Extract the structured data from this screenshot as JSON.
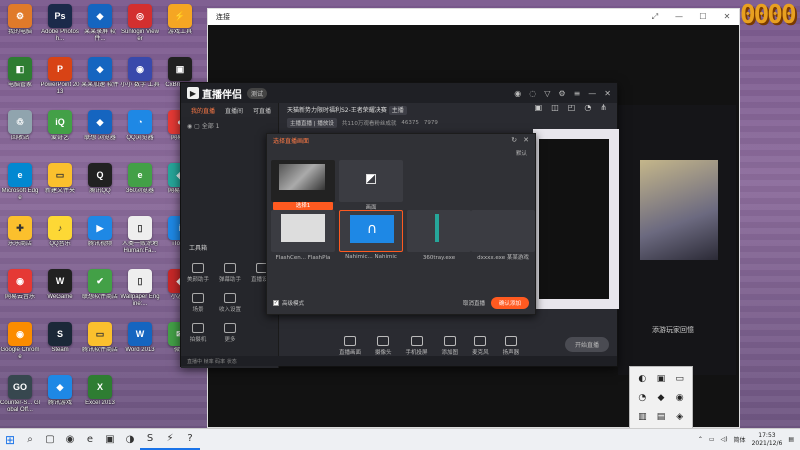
{
  "desktop": {
    "banner": "0000",
    "icons": [
      {
        "label": "我的电脑",
        "color": "#e07a2a",
        "glyph": "⚙"
      },
      {
        "label": "Adobe Photosh...",
        "color": "#1b2a4a",
        "glyph": "Ps"
      },
      {
        "label": "某某录屏 软件...",
        "color": "#1565c0",
        "glyph": "◆"
      },
      {
        "label": "Sunlogin Viewer",
        "color": "#d32f2f",
        "glyph": "◎"
      },
      {
        "label": "游戏工具",
        "color": "#f5a623",
        "glyph": "⚡"
      },
      {
        "label": "电脑管家",
        "color": "#2e7d32",
        "glyph": "◧"
      },
      {
        "label": "PowerPoint 2013",
        "color": "#d84315",
        "glyph": "P"
      },
      {
        "label": "某某加速 软件",
        "color": "#1565c0",
        "glyph": "◆"
      },
      {
        "label": "小小 数字 工具",
        "color": "#3949ab",
        "glyph": "◉"
      },
      {
        "label": "CxBrowser",
        "color": "#212121",
        "glyph": "▣"
      },
      {
        "label": "回收站",
        "color": "#90a4ae",
        "glyph": "♲"
      },
      {
        "label": "爱奇艺",
        "color": "#43a047",
        "glyph": "iQ"
      },
      {
        "label": "联想 浏览器",
        "color": "#1565c0",
        "glyph": "◆"
      },
      {
        "label": "QQ浏览器",
        "color": "#1e88e5",
        "glyph": "◔"
      },
      {
        "label": "网易云",
        "color": "#e53935",
        "glyph": "◐"
      },
      {
        "label": "Microsoft Edge",
        "color": "#0288d1",
        "glyph": "e"
      },
      {
        "label": "新建文件夹",
        "color": "#fbc02d",
        "glyph": "▭"
      },
      {
        "label": "腾讯QQ",
        "color": "#212121",
        "glyph": "Q"
      },
      {
        "label": "360浏览器",
        "color": "#43a047",
        "glyph": "e"
      },
      {
        "label": "网易游戏",
        "color": "#26a69a",
        "glyph": "◈"
      },
      {
        "label": "乐乐商店",
        "color": "#fbc02d",
        "glyph": "✚"
      },
      {
        "label": "QQ音乐",
        "color": "#fdd835",
        "glyph": "♪"
      },
      {
        "label": "腾讯视频",
        "color": "#1e88e5",
        "glyph": "▶"
      },
      {
        "label": "人类一败涂地 Human:Fa...",
        "color": "#eeeeee",
        "glyph": "▯"
      },
      {
        "label": "iTools",
        "color": "#1e88e5",
        "glyph": "i"
      },
      {
        "label": "网易云音乐",
        "color": "#e53935",
        "glyph": "◉"
      },
      {
        "label": "WeGame",
        "color": "#212121",
        "glyph": "W"
      },
      {
        "label": "联想软件商店",
        "color": "#43a047",
        "glyph": "✔"
      },
      {
        "label": "Wallpaper Engine:...",
        "color": "#eeeeee",
        "glyph": "▯"
      },
      {
        "label": "小游戏",
        "color": "#c62828",
        "glyph": "◆"
      },
      {
        "label": "Google Chrome",
        "color": "#fb8c00",
        "glyph": "◉"
      },
      {
        "label": "Steam",
        "color": "#1b2838",
        "glyph": "S"
      },
      {
        "label": "腾讯软件商店",
        "color": "#fbc02d",
        "glyph": "▭"
      },
      {
        "label": "Word 2013",
        "color": "#1565c0",
        "glyph": "W"
      },
      {
        "label": "微信",
        "color": "#43a047",
        "glyph": "✉"
      },
      {
        "label": "Counter-S... Global Off...",
        "color": "#37474f",
        "glyph": "GO"
      },
      {
        "label": "腾讯游戏",
        "color": "#1e88e5",
        "glyph": "◆"
      },
      {
        "label": "Excel 2013",
        "color": "#2e7d32",
        "glyph": "X"
      }
    ]
  },
  "bg_window": {
    "title": "连接"
  },
  "app": {
    "logo_text": "直播伴侣",
    "badge": "测试",
    "tabs": [
      "我的直播",
      "直播间",
      "可直播"
    ],
    "left_sub": "全部 1",
    "tools_title": "工具箱",
    "tools": [
      "美颜助手",
      "弹幕助手",
      "直播设置",
      "场景",
      "收入设置",
      "拍摄机",
      "更多"
    ],
    "stream_title": "天猫新势力限时福利S2-王者荣耀决赛",
    "stream_tag": "主播",
    "stream_meta_1": "主播直播 | 播放设",
    "stream_meta_2": "共110万观看粉丝成就",
    "stream_meta_3": "46375",
    "stream_meta_4": "7979",
    "bottom": [
      "直播画面",
      "摄像头",
      "手机投屏",
      "添加图",
      "麦克风",
      "扬声器"
    ],
    "live_button": "开始直播",
    "status": "直播中 帧率 码率 状态"
  },
  "dialog": {
    "title": "选择直播画面",
    "sub": "默认",
    "thumbs": [
      {
        "label": "选择1"
      },
      {
        "label": "画面"
      },
      {
        "label": "FlashCen... FlashPla"
      },
      {
        "label": "Nahimic... Nahimic"
      },
      {
        "label": "360tray.exe"
      },
      {
        "label": "dxxxx.exe 某某游戏"
      }
    ],
    "selected_label": "选择1",
    "checkbox_label": "高级模式",
    "cancel": "取消直播",
    "ok": "确认添加"
  },
  "game": {
    "footer": "添游玩家回憶"
  },
  "tray_icons": [
    "◐",
    "▣",
    "▭",
    "◔",
    "◆",
    "◉",
    "▥",
    "▤",
    "◈"
  ],
  "taskbar": {
    "items": [
      "⊞",
      "⌕",
      "▢",
      "◉",
      "e",
      "▣",
      "◑",
      "S",
      "⚡",
      "?"
    ],
    "lang": "简体",
    "time": "17:53",
    "date": "2021/12/6"
  },
  "colors": {
    "accent": "#ff5a20",
    "app_bg": "#2a2b31"
  }
}
